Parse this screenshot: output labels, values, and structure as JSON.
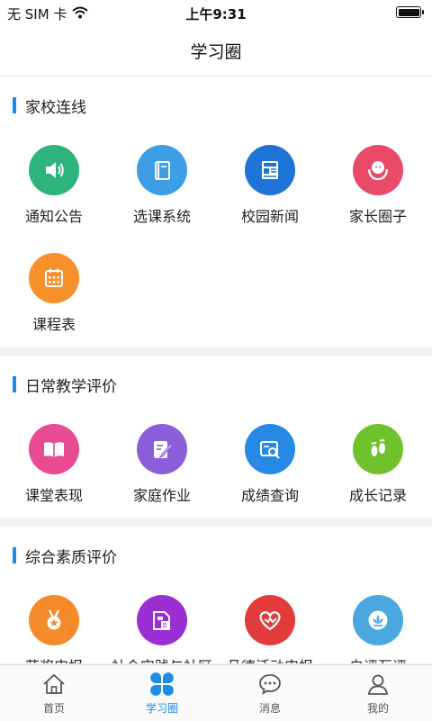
{
  "status_bar": {
    "carrier": "无 SIM 卡",
    "time": "上午9:31",
    "battery_level": 1.0
  },
  "header": {
    "title": "学习圈"
  },
  "sections": [
    {
      "title": "家校连线",
      "items": [
        {
          "label": "通知公告",
          "icon": "speaker-icon",
          "color": "#2db37c"
        },
        {
          "label": "选课系统",
          "icon": "book-icon",
          "color": "#3d9ee5"
        },
        {
          "label": "校园新闻",
          "icon": "newspaper-icon",
          "color": "#1e73d6"
        },
        {
          "label": "家长圈子",
          "icon": "parent-circle-icon",
          "color": "#e84a67"
        },
        {
          "label": "课程表",
          "icon": "calendar-icon",
          "color": "#f5902a"
        }
      ]
    },
    {
      "title": "日常教学评价",
      "items": [
        {
          "label": "课堂表现",
          "icon": "open-book-icon",
          "color": "#e94b93"
        },
        {
          "label": "家庭作业",
          "icon": "edit-note-icon",
          "color": "#8b5fd9"
        },
        {
          "label": "成绩查询",
          "icon": "search-report-icon",
          "color": "#2689e3"
        },
        {
          "label": "成长记录",
          "icon": "footprints-icon",
          "color": "#6fc22c"
        }
      ]
    },
    {
      "title": "综合素质评价",
      "items": [
        {
          "label": "获奖申报",
          "icon": "medal-icon",
          "color": "#f58a2a"
        },
        {
          "label": "社会实践与社区",
          "icon": "document-flag-icon",
          "color": "#9a2fd3"
        },
        {
          "label": "品德活动申报",
          "icon": "heart-icon",
          "color": "#e23b3b"
        },
        {
          "label": "自评互评",
          "icon": "lotus-icon",
          "color": "#4aa7e0"
        }
      ]
    }
  ],
  "tabbar": {
    "tabs": [
      {
        "label": "首页",
        "icon": "home-icon"
      },
      {
        "label": "学习圈",
        "icon": "clover-icon"
      },
      {
        "label": "消息",
        "icon": "chat-bubble-icon"
      },
      {
        "label": "我的",
        "icon": "user-icon"
      }
    ],
    "active_color": "#1e8ce6"
  }
}
